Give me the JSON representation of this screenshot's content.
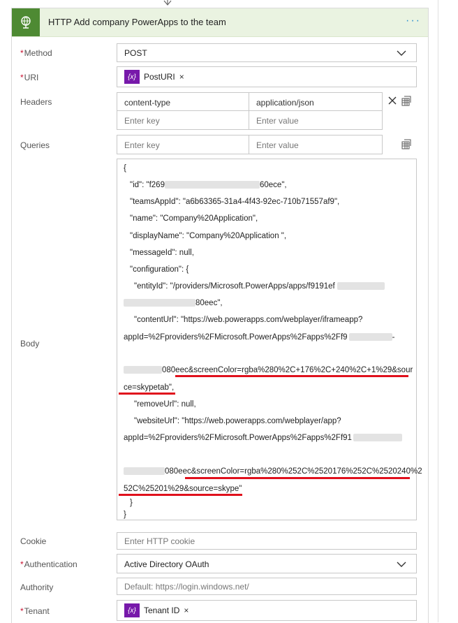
{
  "header": {
    "title": "HTTP Add company PowerApps to the team",
    "menu": "···",
    "icon": "globe-icon"
  },
  "method": {
    "label": "Method",
    "value": "POST"
  },
  "uri": {
    "label": "URI",
    "token": "PostURI",
    "token_icon": "{x}",
    "remove": "×"
  },
  "headers": {
    "label": "Headers",
    "rows": [
      {
        "key": "content-type",
        "value": "application/json"
      },
      {
        "key": "Enter key",
        "value": "Enter value"
      }
    ]
  },
  "queries": {
    "label": "Queries",
    "key_placeholder": "Enter key",
    "value_placeholder": "Enter value"
  },
  "body": {
    "label": "Body",
    "lines": [
      "{",
      "  \"id\": \"f269",
      "60ece\",",
      "  \"teamsAppId\": \"a6b63365-31a4-4f43-92ec-710b71557af9\",",
      "  \"name\": \"Company%20Application\",",
      "  \"displayName\": \"Company%20Application \",",
      "  \"messageId\": null,",
      "  \"configuration\": {",
      "    \"entityId\": \"/providers/Microsoft.PowerApps/apps/f9191ef",
      "80eec\",",
      "    \"contentUrl\": \"https://web.powerapps.com/webplayer/iframeapp?",
      "appId=%2Fproviders%2FMicrosoft.PowerApps%2Fapps%2Ff9",
      "-",
      "080eec&screenColor=rgba%280%2C+176%2C+240%2C+1%29&sour",
      "ce=skypetab\",",
      "    \"removeUrl\": null,",
      "    \"websiteUrl\": \"https://web.powerapps.com/webplayer/app?",
      "appId=%2Fproviders%2FMicrosoft.PowerApps%2Fapps%2Ff91",
      "080eec&screenColor=rgba%280%252C%2520176%252C%2520240%2",
      "52C%25201%29&source=skype\"",
      "  }",
      "}"
    ]
  },
  "cookie": {
    "label": "Cookie",
    "placeholder": "Enter HTTP cookie"
  },
  "authentication": {
    "label": "Authentication",
    "value": "Active Directory OAuth"
  },
  "authority": {
    "label": "Authority",
    "placeholder": "Default: https://login.windows.net/"
  },
  "tenant": {
    "label": "Tenant",
    "token": "Tenant ID",
    "token_icon": "{x}",
    "remove": "×"
  },
  "required_mark": "*",
  "colors": {
    "header_bg": "#eaf3e1",
    "icon_bg": "#4e8a33",
    "token_bg": "#7719aa",
    "underline": "#e0101c"
  }
}
